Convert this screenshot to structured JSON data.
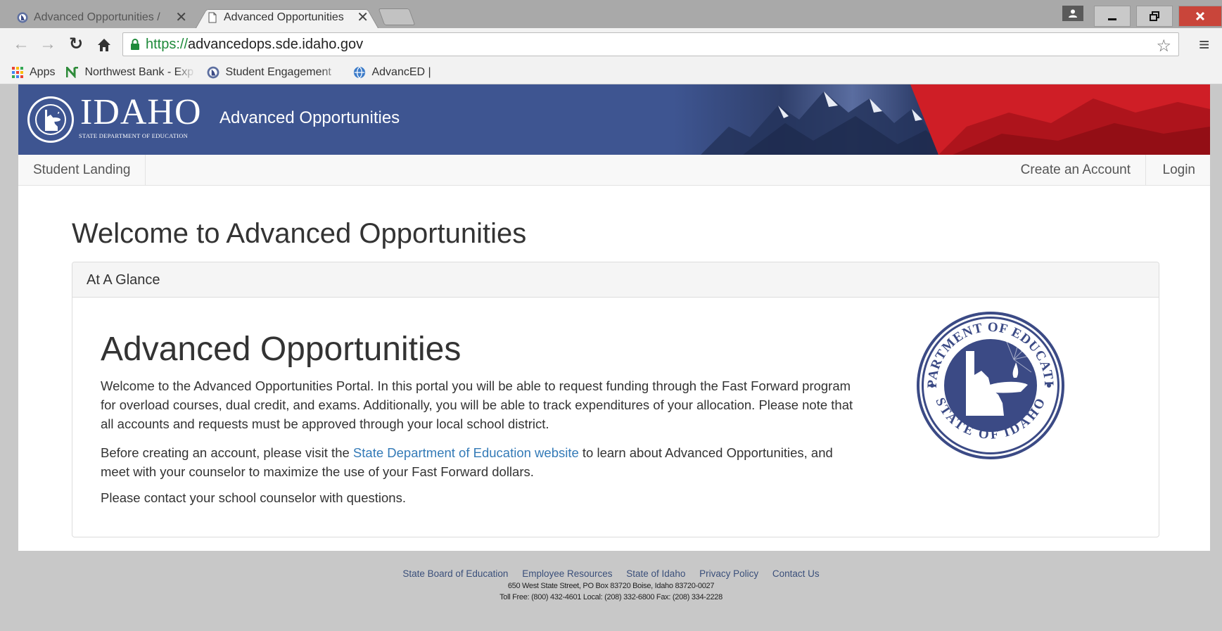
{
  "browser": {
    "tabs": [
      {
        "title": "Advanced Opportunities /",
        "active": false
      },
      {
        "title": "Advanced Opportunities",
        "active": true
      }
    ],
    "tab_close_glyph": "✕",
    "url_scheme": "https://",
    "url_host": "advancedops.sde.idaho.gov",
    "bookmarks": [
      {
        "label": "Apps",
        "icon": "apps-grid-icon"
      },
      {
        "label": "Northwest Bank - Exp",
        "icon": "northwest-bank-icon"
      },
      {
        "label": "Student Engagement",
        "icon": "sde-seal-icon"
      },
      {
        "label": "AdvancED |",
        "icon": "globe-icon"
      }
    ]
  },
  "banner": {
    "logo_word": "IDAHO",
    "logo_sub": "STATE DEPARTMENT OF EDUCATION",
    "title": "Advanced Opportunities"
  },
  "nav": {
    "student_landing": "Student Landing",
    "create_account": "Create an Account",
    "login": "Login"
  },
  "main": {
    "welcome_title": "Welcome to Advanced Opportunities",
    "panel_heading": "At A Glance",
    "panel_title": "Advanced Opportunities",
    "para1": "Welcome to the Advanced Opportunities Portal. In this portal you will be able to request funding through the Fast Forward program for overload courses, dual credit, and exams. Additionally, you will be able to track expenditures of your allocation. Please note that all accounts and requests must be approved through your local school district.",
    "para2_before": "Before creating an account, please visit the ",
    "para2_link": "State Department of Education website",
    "para2_after": " to learn about Advanced Opportunities, and meet with your counselor to maximize the use of your Fast Forward dollars.",
    "para3": "Please contact your school counselor with questions.",
    "seal_top_text": "DEPARTMENT OF EDUCATION",
    "seal_bottom_text": "STATE OF IDAHO"
  },
  "footer": {
    "links": [
      "State Board of Education",
      "Employee Resources",
      "State of Idaho",
      "Privacy Policy",
      "Contact Us"
    ],
    "address": "650 West State Street, PO Box 83720 Boise, Idaho 83720-0027",
    "phones": "Toll Free: (800) 432-4601 Local: (208) 332-6800 Fax: (208) 334-2228"
  },
  "colors": {
    "banner_blue": "#3e5591",
    "banner_red": "#d11f27",
    "link": "#337ab7",
    "seal_navy": "#3b4a85"
  }
}
